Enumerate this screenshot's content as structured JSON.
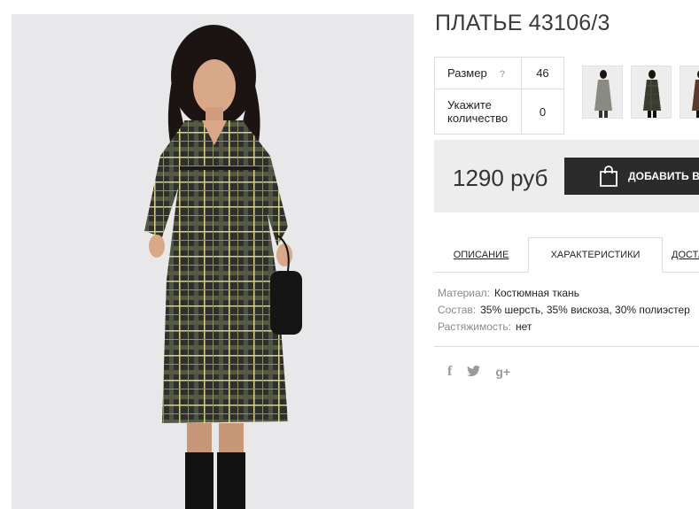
{
  "product": {
    "title": "ПЛАТЬЕ 43106/3"
  },
  "options": {
    "size_label": "Размер",
    "size_help": "?",
    "size_value": "46",
    "qty_label": "Укажите количество",
    "qty_value": "0"
  },
  "buy": {
    "price": "1290 руб",
    "add_label": "ДОБАВИТЬ В КОРЗИНУ"
  },
  "tabs": [
    {
      "label": "ОПИСАНИЕ"
    },
    {
      "label": "ХАРАКТЕРИСТИКИ"
    },
    {
      "label": "ДОСТАВКА"
    }
  ],
  "characteristics": [
    {
      "key": "Материал:",
      "value": "Костюмная ткань"
    },
    {
      "key": "Состав:",
      "value": "35% шерсть, 35% вискоза, 30% полиэстер"
    },
    {
      "key": "Растяжимость:",
      "value": "нет"
    }
  ],
  "social": {
    "fb": "f",
    "tw": "🐦",
    "gp": "g+"
  },
  "colors": {
    "accent_dark": "#2b2b2b",
    "buy_box_bg": "#ededed",
    "photo_bg": "#e8e8ea"
  }
}
